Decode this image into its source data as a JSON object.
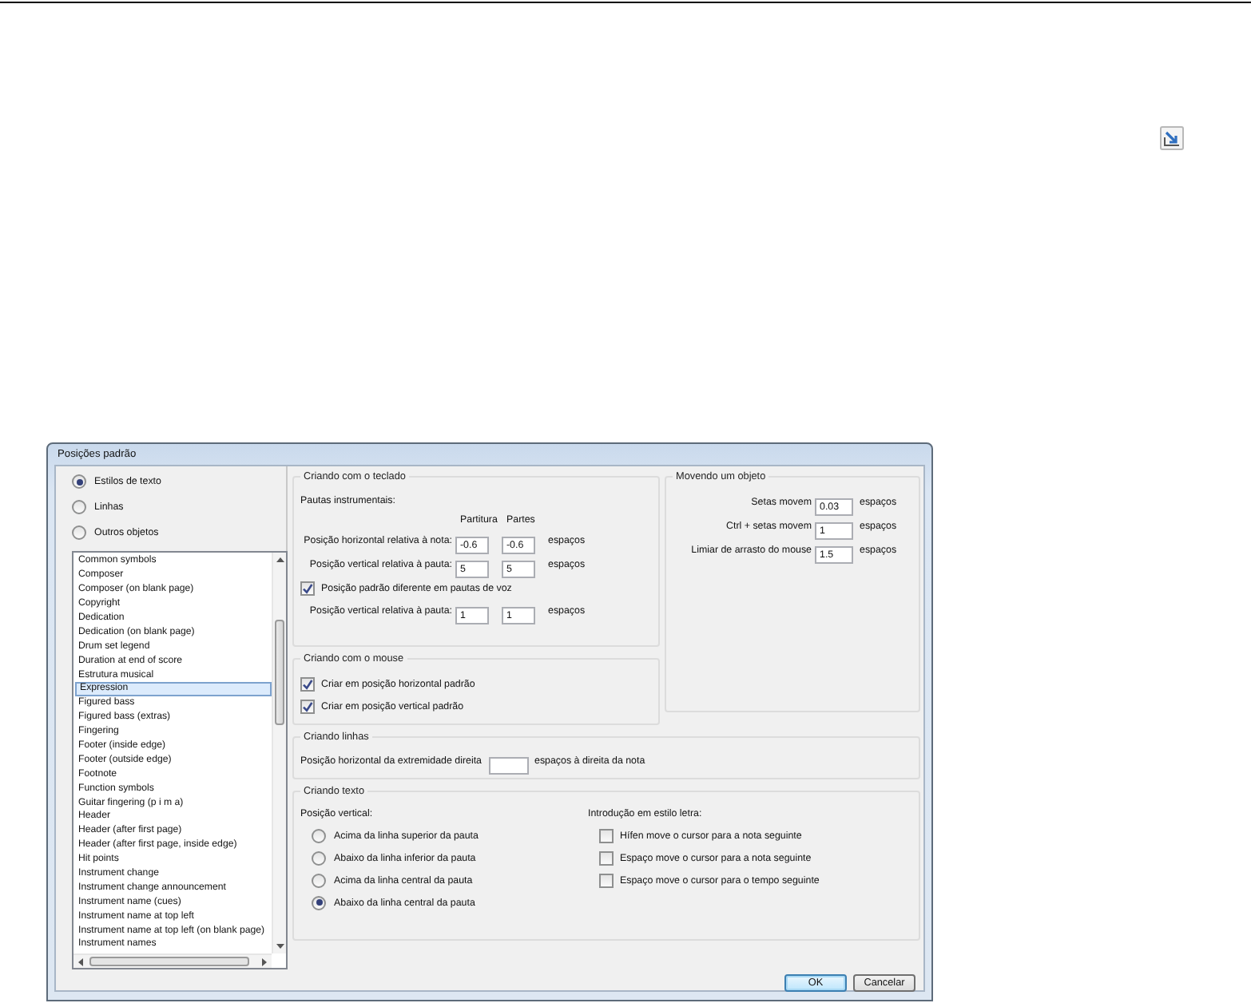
{
  "dialog": {
    "title": "Posições padrão"
  },
  "category_options": [
    {
      "label": "Estilos de texto",
      "selected": true
    },
    {
      "label": "Linhas",
      "selected": false
    },
    {
      "label": "Outros objetos",
      "selected": false
    }
  ],
  "style_list": {
    "items": [
      {
        "label": "Common symbols",
        "selected": false
      },
      {
        "label": "Composer",
        "selected": false
      },
      {
        "label": "Composer (on blank page)",
        "selected": false
      },
      {
        "label": "Copyright",
        "selected": false
      },
      {
        "label": "Dedication",
        "selected": false
      },
      {
        "label": "Dedication (on blank page)",
        "selected": false
      },
      {
        "label": "Drum set legend",
        "selected": false
      },
      {
        "label": "Duration at end of score",
        "selected": false
      },
      {
        "label": "Estrutura musical",
        "selected": false
      },
      {
        "label": "Expression",
        "selected": true
      },
      {
        "label": "Figured bass",
        "selected": false
      },
      {
        "label": "Figured bass (extras)",
        "selected": false
      },
      {
        "label": "Fingering",
        "selected": false
      },
      {
        "label": "Footer (inside edge)",
        "selected": false
      },
      {
        "label": "Footer (outside edge)",
        "selected": false
      },
      {
        "label": "Footnote",
        "selected": false
      },
      {
        "label": "Function symbols",
        "selected": false
      },
      {
        "label": "Guitar fingering (p i m a)",
        "selected": false
      },
      {
        "label": "Header",
        "selected": false
      },
      {
        "label": "Header (after first page)",
        "selected": false
      },
      {
        "label": "Header (after first page, inside edge)",
        "selected": false
      },
      {
        "label": "Hit points",
        "selected": false
      },
      {
        "label": "Instrument change",
        "selected": false
      },
      {
        "label": "Instrument change announcement",
        "selected": false
      },
      {
        "label": "Instrument name (cues)",
        "selected": false
      },
      {
        "label": "Instrument name at top left",
        "selected": false
      },
      {
        "label": "Instrument name at top left (on blank page)",
        "selected": false
      },
      {
        "label": "Instrument names",
        "selected": false
      }
    ]
  },
  "keyboard": {
    "title": "Criando com o teclado",
    "subtitle": "Pautas instrumentais:",
    "column_headers": [
      "Partitura",
      "Partes"
    ],
    "rows": [
      {
        "kind": "field",
        "label": "Posição horizontal relativa à nota:",
        "score": "-0.6",
        "parts": "-0.6",
        "unit": "espaços"
      },
      {
        "kind": "field",
        "label": "Posição vertical relativa à pauta:",
        "score": "5",
        "parts": "5",
        "unit": "espaços"
      },
      {
        "kind": "checkbox",
        "label": "Posição padrão diferente em pautas de voz",
        "checked": true
      },
      {
        "kind": "field",
        "label": "Posição vertical relativa à pauta:",
        "score": "1",
        "parts": "1",
        "unit": "espaços"
      }
    ]
  },
  "mouse": {
    "title": "Criando com o mouse",
    "options": [
      {
        "label": "Criar em posição horizontal padrão",
        "checked": true
      },
      {
        "label": "Criar em posição vertical padrão",
        "checked": true
      }
    ]
  },
  "moving": {
    "title": "Movendo um objeto",
    "rows": [
      {
        "label": "Setas movem",
        "value": "0.03",
        "unit": "espaços"
      },
      {
        "label": "Ctrl + setas movem",
        "value": "1",
        "unit": "espaços"
      },
      {
        "label": "Limiar de arrasto do mouse",
        "value": "1.5",
        "unit": "espaços"
      }
    ]
  },
  "lines": {
    "title": "Criando linhas",
    "label": "Posição horizontal da extremidade direita",
    "unit": "espaços à direita da nota"
  },
  "text": {
    "title": "Criando texto",
    "vertical_label": "Posição vertical:",
    "vertical_options": [
      {
        "label": "Acima da linha superior da pauta",
        "selected": false
      },
      {
        "label": "Abaixo da linha inferior da pauta",
        "selected": false
      },
      {
        "label": "Acima da linha central da pauta",
        "selected": false
      },
      {
        "label": "Abaixo da linha central da pauta",
        "selected": true
      }
    ],
    "lyrics_label": "Introdução em estilo letra:",
    "lyrics_options": [
      {
        "label": "Hífen move o cursor para a nota seguinte",
        "checked": false
      },
      {
        "label": "Espaço move o cursor para a nota seguinte",
        "checked": false
      },
      {
        "label": "Espaço move o cursor para o tempo seguinte",
        "checked": false
      }
    ]
  },
  "buttons": [
    {
      "label": "OK",
      "default": true
    },
    {
      "label": "Cancelar",
      "default": false
    }
  ]
}
